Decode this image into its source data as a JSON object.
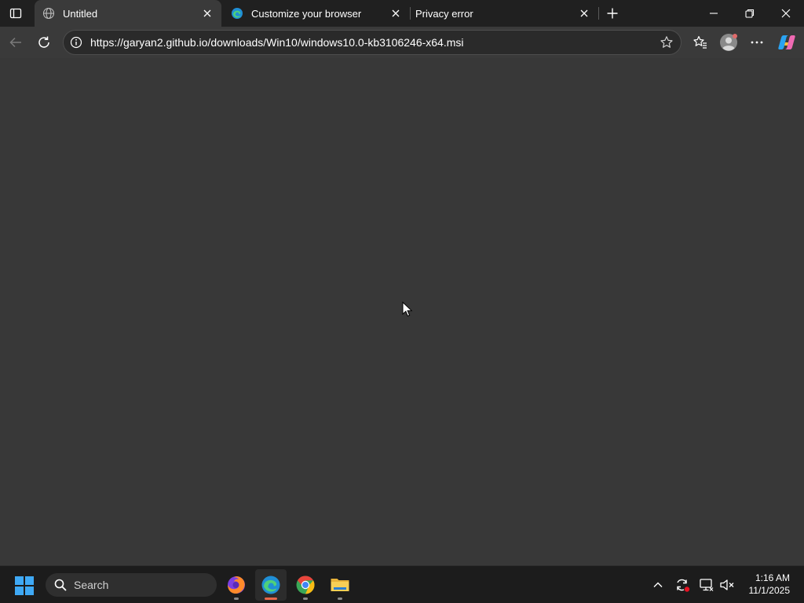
{
  "browser": {
    "tabs": [
      {
        "title": "Untitled",
        "icon": "globe-icon",
        "active": true
      },
      {
        "title": "Customize your browser",
        "icon": "edge-icon",
        "active": false
      },
      {
        "title": "Privacy error",
        "icon": "none",
        "active": false
      }
    ],
    "address_bar": {
      "url": "https://garyan2.github.io/downloads/Win10/windows10.0-kb3106246-x64.msi"
    }
  },
  "taskbar": {
    "search_label": "Search",
    "apps": [
      "firefox-icon",
      "edge-icon",
      "chrome-icon",
      "file-explorer-icon"
    ],
    "active_app": "edge-icon",
    "clock": {
      "time": "1:16 AM",
      "date": "11/1/2025"
    }
  },
  "colors": {
    "page_background": "#383838",
    "titlebar": "#202020",
    "toolbar": "#3a3a3a",
    "taskbar": "#1c1c1c",
    "active_indicator": "#e8674a"
  }
}
